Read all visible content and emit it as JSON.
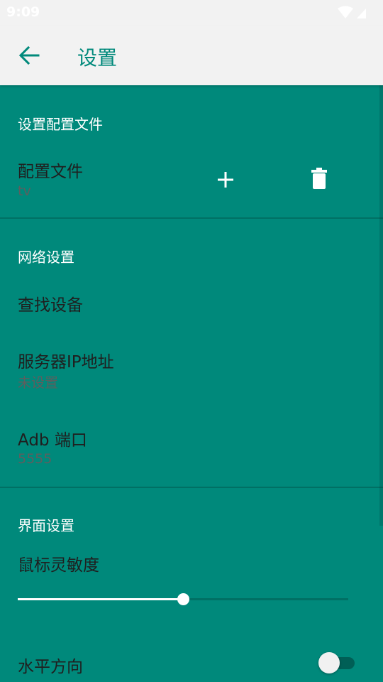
{
  "status_bar": {
    "time": "9:09",
    "wifi_icon": "wifi-icon",
    "signal_icon": "signal-icon"
  },
  "app_bar": {
    "back_icon": "arrow-left-icon",
    "title": "设置"
  },
  "colors": {
    "primary": "#00897B",
    "app_bar_bg": "#F2F2F2",
    "text_dark": "#1F1F1F",
    "text_secondary": "#5E5E5E",
    "white": "#FFFFFF"
  },
  "sections": {
    "profile": {
      "title": "设置配置文件",
      "item": {
        "title": "配置文件",
        "value": "tv",
        "add_icon": "plus-icon",
        "delete_icon": "trash-icon"
      }
    },
    "network": {
      "title": "网络设置",
      "find_device": {
        "title": "查找设备"
      },
      "server_ip": {
        "title": "服务器IP地址",
        "value": "未设置"
      },
      "adb_port": {
        "title": "Adb 端口",
        "value": "5555"
      }
    },
    "ui": {
      "title": "界面设置",
      "mouse_sensitivity": {
        "title": "鼠标灵敏度",
        "value_fraction": 0.5
      },
      "horizontal": {
        "title": "水平方向",
        "enabled": false
      }
    }
  }
}
